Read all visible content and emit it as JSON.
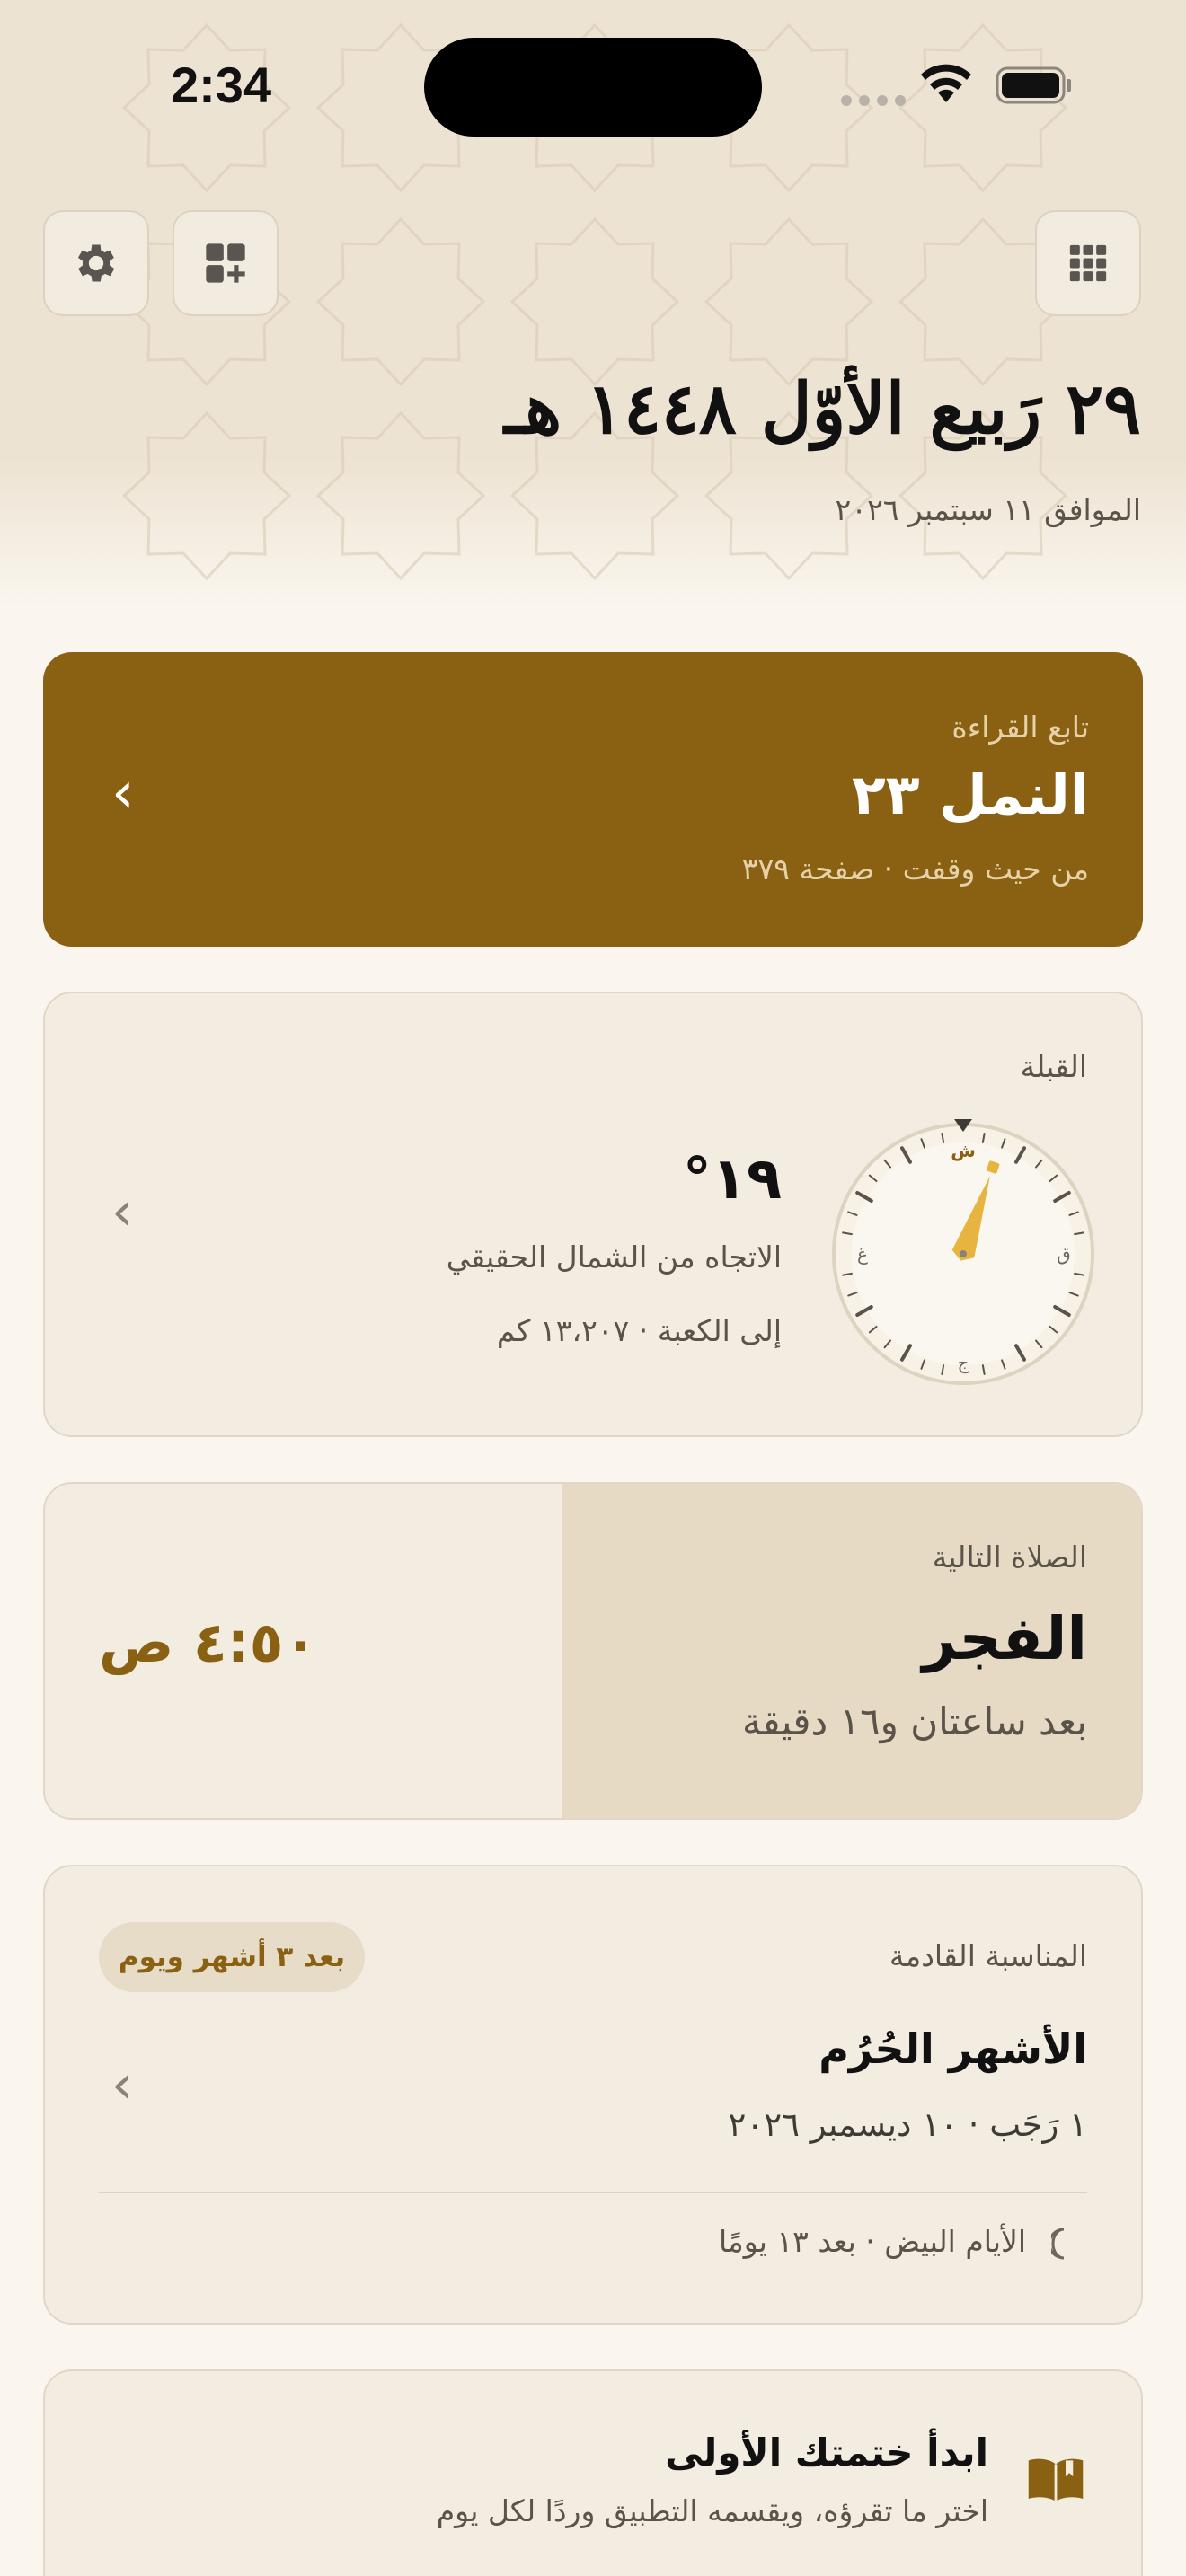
{
  "status": {
    "time": "2:34"
  },
  "header": {
    "hijri_date": "٢٩ رَبيع الأوّل ١٤٤٨ هـ",
    "gregorian_date": "الموافق ١١ سبتمبر ٢٠٢٦",
    "buttons": {
      "settings_icon": "gear-icon",
      "add_widget_icon": "widget-add-icon",
      "apps_icon": "grid-icon"
    }
  },
  "reading": {
    "label": "تابع القراءة",
    "surah": "النمل ٢٣",
    "detail": "من حيث وقفت · صفحة ٣٧٩",
    "bg_color": "#8a6112"
  },
  "qibla": {
    "label": "القبلة",
    "degrees": "١٩°",
    "direction_text": "الاتجاه من الشمال الحقيقي",
    "distance_text": "إلى الكعبة · ١٣،٢٠٧ كم",
    "compass": {
      "north": "ش",
      "east": "ق",
      "south": "ج",
      "west": "غ",
      "needle_color": "#e8b440",
      "heading_degrees": 19
    }
  },
  "prayer": {
    "label": "الصلاة التالية",
    "name": "الفجر",
    "countdown": "بعد ساعتان و١٦ دقيقة",
    "time": "٤:٥٠ ص",
    "time_color": "#8a6112"
  },
  "occasion": {
    "label": "المناسبة القادمة",
    "badge": "بعد ٣ أشهر ويوم",
    "title": "الأشهر الحُرُم",
    "date": "١ رَجَب · ١٠ ديسمبر ٢٠٢٦",
    "footer": "الأيام البيض · بعد ١٣ يومًا",
    "footer_icon": "crescent-moon-icon"
  },
  "khatma": {
    "title": "ابدأ ختمتك الأولى",
    "subtitle": "اختر ما تقرؤه، ويقسمه التطبيق وردًا لكل يوم",
    "icon": "open-book-icon"
  }
}
